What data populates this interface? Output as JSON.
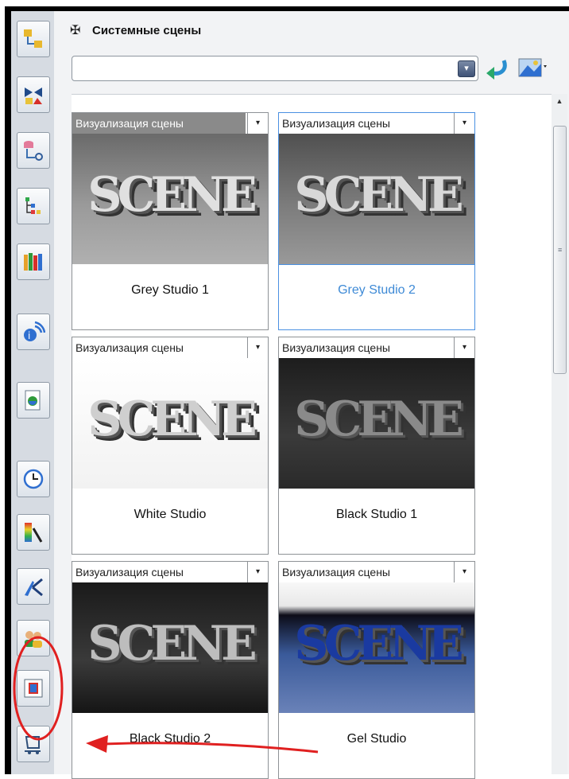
{
  "panel": {
    "title": "Системные сцены",
    "combo_value": "",
    "combo_arrow": "▾"
  },
  "cards": [
    {
      "header": "Визуализация сцены",
      "name": "Grey Studio 1",
      "thumb_text": "SCENE",
      "selected": false
    },
    {
      "header": "Визуализация сцены",
      "name": "Grey Studio 2",
      "thumb_text": "SCENE",
      "selected": true
    },
    {
      "header": "Визуализация сцены",
      "name": "White Studio",
      "thumb_text": "SCENE",
      "selected": false
    },
    {
      "header": "Визуализация сцены",
      "name": "Black Studio 1",
      "thumb_text": "SCENE",
      "selected": false
    },
    {
      "header": "Визуализация сцены",
      "name": "Black Studio 2",
      "thumb_text": "SCENE",
      "selected": false
    },
    {
      "header": "Визуализация сцены",
      "name": "Gel Studio",
      "thumb_text": "SCENE",
      "selected": false
    }
  ],
  "dropdown_glyph": "▾",
  "scroll": {
    "up_glyph": "▲",
    "grip_glyph": "≡"
  },
  "sidebar_icons": [
    "assembly-tree-icon",
    "constraints-icon",
    "database-tree-icon",
    "hierarchy-icon",
    "library-books-icon",
    "info-feed-icon",
    "document-globe-icon",
    "history-clock-icon",
    "color-palette-icon",
    "tools-icon",
    "users-icon",
    "scenes-icon",
    "render-cart-icon"
  ],
  "colors": {
    "selection": "#4a90e2",
    "annotation_red": "#e02020"
  }
}
